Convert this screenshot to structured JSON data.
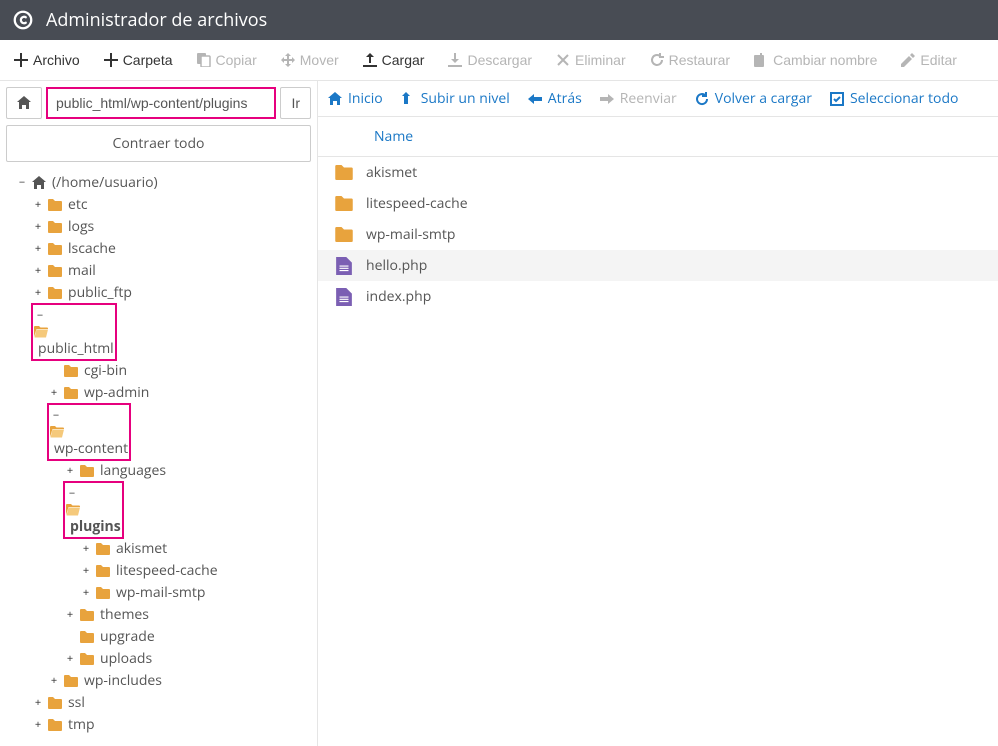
{
  "header": {
    "title": "Administrador de archivos"
  },
  "toolbar": {
    "archivo": "Archivo",
    "carpeta": "Carpeta",
    "copiar": "Copiar",
    "mover": "Mover",
    "cargar": "Cargar",
    "descargar": "Descargar",
    "eliminar": "Eliminar",
    "restaurar": "Restaurar",
    "cambiar_nombre": "Cambiar nombre",
    "editar": "Editar"
  },
  "path": {
    "value": "public_html/wp-content/plugins",
    "go": "Ir",
    "collapse": "Contraer todo"
  },
  "content_toolbar": {
    "inicio": "Inicio",
    "subir": "Subir un nivel",
    "atras": "Atrás",
    "reenviar": "Reenviar",
    "volver": "Volver a cargar",
    "seleccionar": "Seleccionar todo"
  },
  "table": {
    "header_name": "Name"
  },
  "tree": {
    "root": "(/home/usuario)",
    "etc": "etc",
    "logs": "logs",
    "lscache": "lscache",
    "mail": "mail",
    "public_ftp": "public_ftp",
    "public_html": "public_html",
    "cgi_bin": "cgi-bin",
    "wp_admin": "wp-admin",
    "wp_content": "wp-content",
    "languages": "languages",
    "plugins": "plugins",
    "akismet": "akismet",
    "litespeed_cache": "litespeed-cache",
    "wp_mail_smtp": "wp-mail-smtp",
    "themes": "themes",
    "upgrade": "upgrade",
    "uploads": "uploads",
    "wp_includes": "wp-includes",
    "ssl": "ssl",
    "tmp": "tmp"
  },
  "files": [
    {
      "name": "akismet",
      "type": "folder"
    },
    {
      "name": "litespeed-cache",
      "type": "folder"
    },
    {
      "name": "wp-mail-smtp",
      "type": "folder"
    },
    {
      "name": "hello.php",
      "type": "file",
      "selected": true
    },
    {
      "name": "index.php",
      "type": "file"
    }
  ]
}
